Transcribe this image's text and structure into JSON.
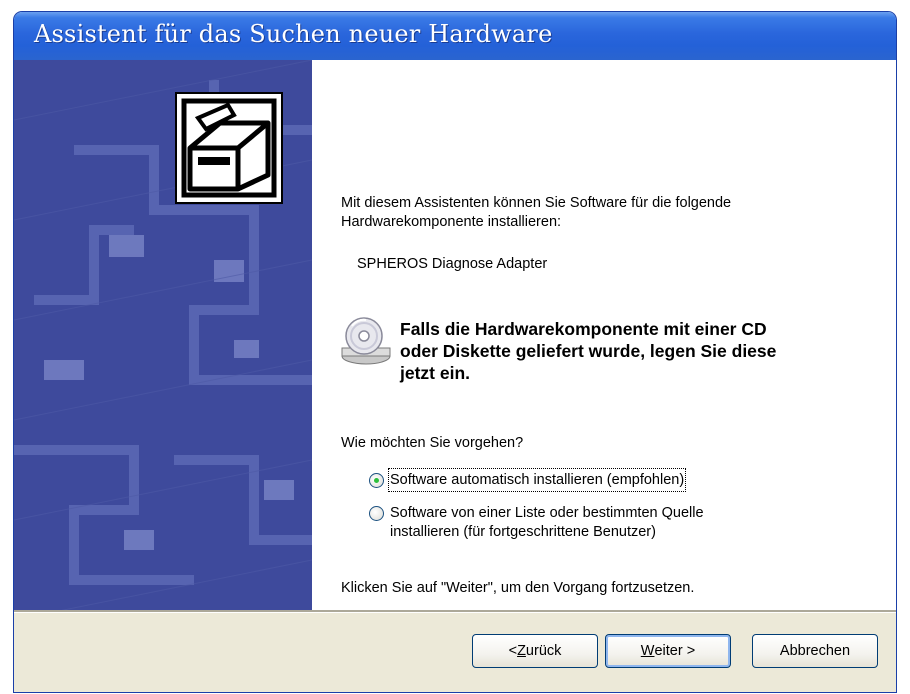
{
  "window": {
    "title": "Assistent für das Suchen neuer Hardware"
  },
  "content": {
    "intro_line1": "Mit diesem Assistenten können Sie Software für die folgende",
    "intro_line2": "Hardwarekomponente installieren:",
    "device_name": "SPHEROS Diagnose Adapter",
    "cd_notice_line1": "Falls die Hardwarekomponente mit einer CD",
    "cd_notice_line2": "oder Diskette geliefert wurde, legen Sie diese",
    "cd_notice_line3": "jetzt ein.",
    "question": "Wie möchten Sie vorgehen?",
    "options": [
      {
        "label_line1": "Software automatisch installieren (empfohlen)",
        "label_line2": "",
        "selected": true,
        "access_key": "a"
      },
      {
        "label_line1": "Software von einer Liste oder bestimmten Quelle",
        "label_line2": "installieren (für fortgeschrittene Benutzer)",
        "selected": false,
        "access_key": "L"
      }
    ],
    "continue_hint": "Klicken Sie auf \"Weiter\", um den Vorgang fortzusetzen."
  },
  "buttons": {
    "back_prefix": "< ",
    "back_key": "Z",
    "back_rest": "urück",
    "next_key": "W",
    "next_rest": "eiter >",
    "cancel": "Abbrechen"
  },
  "icons": {
    "wizard": "hardware-drive-icon",
    "cd": "cd-drive-icon"
  },
  "colors": {
    "titlebar": "#2461d8",
    "side_panel": "#3e4a9c",
    "footer": "#ece9d8"
  }
}
